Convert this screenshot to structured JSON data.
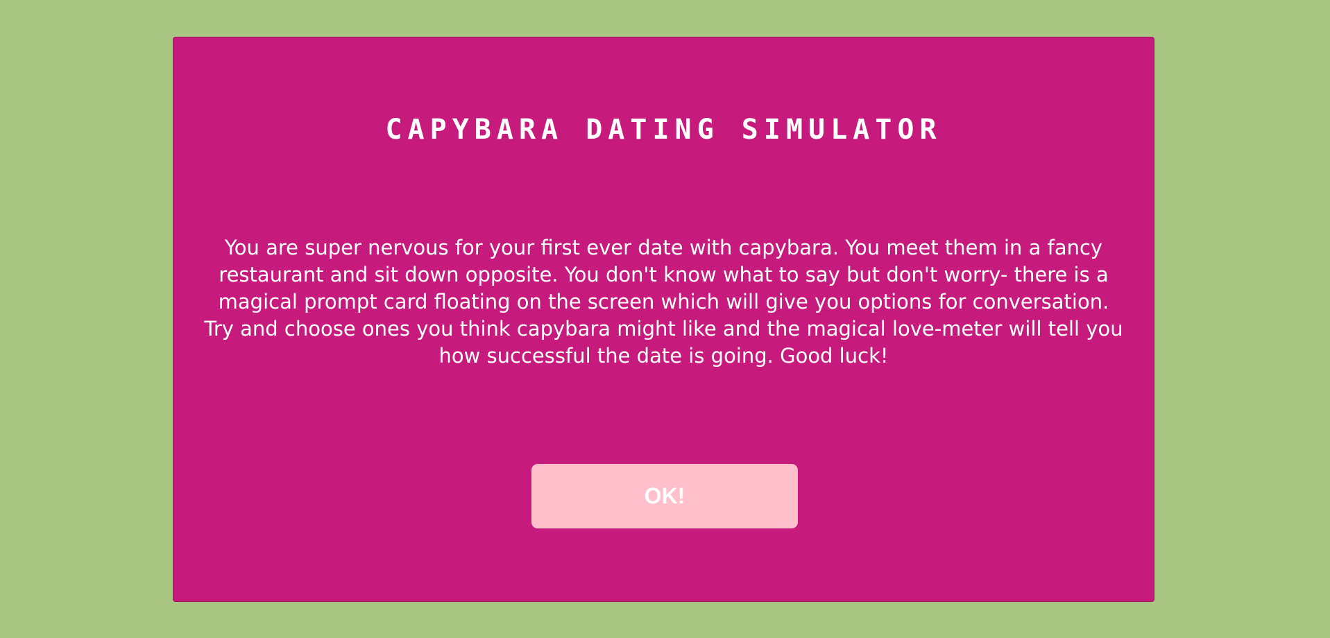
{
  "modal": {
    "title": "Capybara Dating Simulator",
    "intro_text": "You are super nervous for your first ever date with capybara. You meet them in a fancy restaurant and sit down opposite. You don't know what to say but don't worry- there is a magical prompt card floating on the screen which will give you options for conversation. Try and choose ones you think capybara might like and the magical love-meter will tell you how successful the date is going. Good luck!",
    "ok_label": "OK!"
  },
  "colors": {
    "background": "#a8c582",
    "modal": "#c61b7d",
    "button": "#ffc0cb",
    "text": "#ffffff"
  }
}
